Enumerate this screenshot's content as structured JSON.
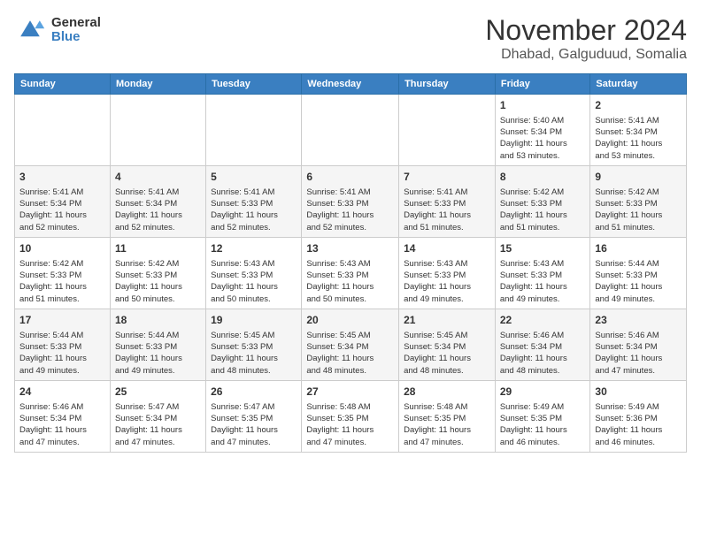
{
  "logo": {
    "general": "General",
    "blue": "Blue"
  },
  "title": "November 2024",
  "location": "Dhabad, Galguduud, Somalia",
  "days_of_week": [
    "Sunday",
    "Monday",
    "Tuesday",
    "Wednesday",
    "Thursday",
    "Friday",
    "Saturday"
  ],
  "weeks": [
    [
      {
        "day": "",
        "info": ""
      },
      {
        "day": "",
        "info": ""
      },
      {
        "day": "",
        "info": ""
      },
      {
        "day": "",
        "info": ""
      },
      {
        "day": "",
        "info": ""
      },
      {
        "day": "1",
        "info": "Sunrise: 5:40 AM\nSunset: 5:34 PM\nDaylight: 11 hours\nand 53 minutes."
      },
      {
        "day": "2",
        "info": "Sunrise: 5:41 AM\nSunset: 5:34 PM\nDaylight: 11 hours\nand 53 minutes."
      }
    ],
    [
      {
        "day": "3",
        "info": "Sunrise: 5:41 AM\nSunset: 5:34 PM\nDaylight: 11 hours\nand 52 minutes."
      },
      {
        "day": "4",
        "info": "Sunrise: 5:41 AM\nSunset: 5:34 PM\nDaylight: 11 hours\nand 52 minutes."
      },
      {
        "day": "5",
        "info": "Sunrise: 5:41 AM\nSunset: 5:33 PM\nDaylight: 11 hours\nand 52 minutes."
      },
      {
        "day": "6",
        "info": "Sunrise: 5:41 AM\nSunset: 5:33 PM\nDaylight: 11 hours\nand 52 minutes."
      },
      {
        "day": "7",
        "info": "Sunrise: 5:41 AM\nSunset: 5:33 PM\nDaylight: 11 hours\nand 51 minutes."
      },
      {
        "day": "8",
        "info": "Sunrise: 5:42 AM\nSunset: 5:33 PM\nDaylight: 11 hours\nand 51 minutes."
      },
      {
        "day": "9",
        "info": "Sunrise: 5:42 AM\nSunset: 5:33 PM\nDaylight: 11 hours\nand 51 minutes."
      }
    ],
    [
      {
        "day": "10",
        "info": "Sunrise: 5:42 AM\nSunset: 5:33 PM\nDaylight: 11 hours\nand 51 minutes."
      },
      {
        "day": "11",
        "info": "Sunrise: 5:42 AM\nSunset: 5:33 PM\nDaylight: 11 hours\nand 50 minutes."
      },
      {
        "day": "12",
        "info": "Sunrise: 5:43 AM\nSunset: 5:33 PM\nDaylight: 11 hours\nand 50 minutes."
      },
      {
        "day": "13",
        "info": "Sunrise: 5:43 AM\nSunset: 5:33 PM\nDaylight: 11 hours\nand 50 minutes."
      },
      {
        "day": "14",
        "info": "Sunrise: 5:43 AM\nSunset: 5:33 PM\nDaylight: 11 hours\nand 49 minutes."
      },
      {
        "day": "15",
        "info": "Sunrise: 5:43 AM\nSunset: 5:33 PM\nDaylight: 11 hours\nand 49 minutes."
      },
      {
        "day": "16",
        "info": "Sunrise: 5:44 AM\nSunset: 5:33 PM\nDaylight: 11 hours\nand 49 minutes."
      }
    ],
    [
      {
        "day": "17",
        "info": "Sunrise: 5:44 AM\nSunset: 5:33 PM\nDaylight: 11 hours\nand 49 minutes."
      },
      {
        "day": "18",
        "info": "Sunrise: 5:44 AM\nSunset: 5:33 PM\nDaylight: 11 hours\nand 49 minutes."
      },
      {
        "day": "19",
        "info": "Sunrise: 5:45 AM\nSunset: 5:33 PM\nDaylight: 11 hours\nand 48 minutes."
      },
      {
        "day": "20",
        "info": "Sunrise: 5:45 AM\nSunset: 5:34 PM\nDaylight: 11 hours\nand 48 minutes."
      },
      {
        "day": "21",
        "info": "Sunrise: 5:45 AM\nSunset: 5:34 PM\nDaylight: 11 hours\nand 48 minutes."
      },
      {
        "day": "22",
        "info": "Sunrise: 5:46 AM\nSunset: 5:34 PM\nDaylight: 11 hours\nand 48 minutes."
      },
      {
        "day": "23",
        "info": "Sunrise: 5:46 AM\nSunset: 5:34 PM\nDaylight: 11 hours\nand 47 minutes."
      }
    ],
    [
      {
        "day": "24",
        "info": "Sunrise: 5:46 AM\nSunset: 5:34 PM\nDaylight: 11 hours\nand 47 minutes."
      },
      {
        "day": "25",
        "info": "Sunrise: 5:47 AM\nSunset: 5:34 PM\nDaylight: 11 hours\nand 47 minutes."
      },
      {
        "day": "26",
        "info": "Sunrise: 5:47 AM\nSunset: 5:35 PM\nDaylight: 11 hours\nand 47 minutes."
      },
      {
        "day": "27",
        "info": "Sunrise: 5:48 AM\nSunset: 5:35 PM\nDaylight: 11 hours\nand 47 minutes."
      },
      {
        "day": "28",
        "info": "Sunrise: 5:48 AM\nSunset: 5:35 PM\nDaylight: 11 hours\nand 47 minutes."
      },
      {
        "day": "29",
        "info": "Sunrise: 5:49 AM\nSunset: 5:35 PM\nDaylight: 11 hours\nand 46 minutes."
      },
      {
        "day": "30",
        "info": "Sunrise: 5:49 AM\nSunset: 5:36 PM\nDaylight: 11 hours\nand 46 minutes."
      }
    ]
  ]
}
